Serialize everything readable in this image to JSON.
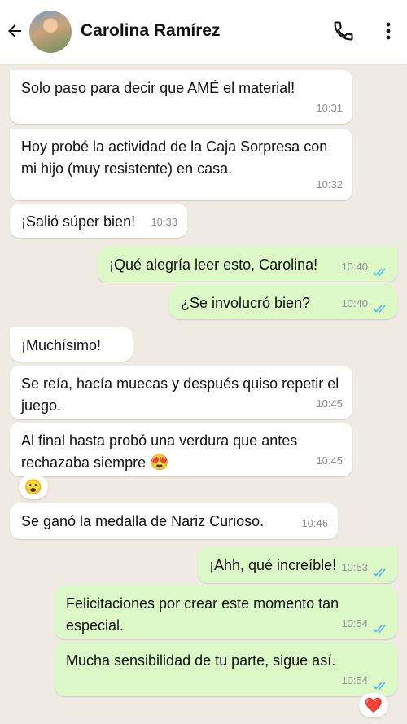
{
  "header": {
    "contact_name": "Carolina Ramírez"
  },
  "messages": [
    {
      "text": "Solo paso para decir que AMÉ el material!",
      "time": "10:31"
    },
    {
      "text": "Hoy probé la actividad de la Caja Sorpresa con mi hijo (muy resistente) en casa.",
      "time": "10:32"
    },
    {
      "text": "¡Salió súper bien!",
      "time": "10:33"
    },
    {
      "text": "¡Qué alegría leer esto, Carolina!",
      "time": "10:40"
    },
    {
      "text": "¿Se involucró bien?",
      "time": "10:40"
    },
    {
      "text": "¡Muchísimo!",
      "time": ""
    },
    {
      "text": "Se reía, hacía muecas y después quiso repetir el juego.",
      "time": "10:45"
    },
    {
      "text": "Al final hasta probó una verdura que antes rechazaba siempre",
      "emoji": "😍",
      "time": "10:45"
    },
    {
      "text": "Se ganó la medalla de Nariz Curioso.",
      "time": "10:46"
    },
    {
      "text": "¡Ahh, qué increíble!",
      "time": "10:53"
    },
    {
      "text": "Felicitaciones por crear este momento tan especial.",
      "time": "10:54"
    },
    {
      "text": "Mucha sensibilidad de tu parte, sigue así.",
      "time": "10:54"
    }
  ],
  "reactions": {
    "surprised": "😮",
    "heart": "❤️"
  },
  "colors": {
    "incoming": "#ffffff",
    "outgoing": "#dcf8c6",
    "background": "#efeae2",
    "read_ticks": "#4fb6ec"
  }
}
